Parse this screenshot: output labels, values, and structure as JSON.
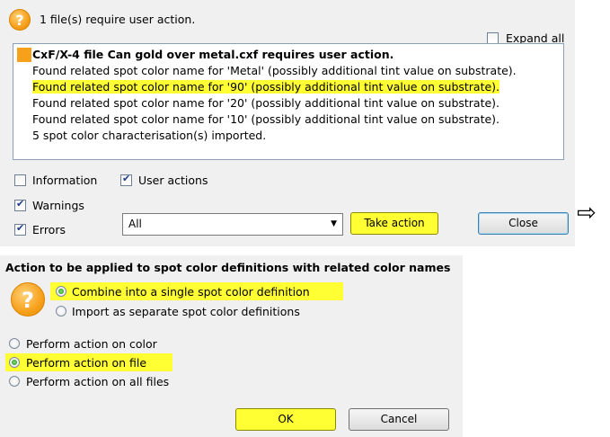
{
  "dialog1": {
    "header_text": "1 file(s) require user action.",
    "expand_all_label": "Expand all",
    "expand_all_checked": false,
    "messages": {
      "title": "CxF/X-4 file Can gold over metal.cxf requires user action.",
      "lines": [
        "Found related spot color name for 'Metal' (possibly additional tint value on substrate).",
        "Found related spot color name for '90' (possibly additional tint value on substrate).",
        "Found related spot color name for '20' (possibly additional tint value on substrate).",
        "Found related spot color name for '10' (possibly additional tint value on substrate).",
        "5 spot color characterisation(s) imported."
      ]
    },
    "filters": {
      "information_label": "Information",
      "information_checked": false,
      "user_actions_label": "User actions",
      "user_actions_checked": true,
      "warnings_label": "Warnings",
      "warnings_checked": true,
      "errors_label": "Errors",
      "errors_checked": true
    },
    "dropdown_value": "All",
    "take_action_label": "Take action",
    "close_label": "Close",
    "highlight_color": "#ffff33",
    "icon": "question-icon"
  },
  "dialog2": {
    "title": "Action to be applied to spot color definitions with related color names",
    "options_group1": [
      {
        "label": "Combine into a single spot color definition",
        "selected": true
      },
      {
        "label": "Import as separate spot color definitions",
        "selected": false
      }
    ],
    "options_group2": [
      {
        "label": "Perform action on color",
        "selected": false
      },
      {
        "label": "Perform action on file",
        "selected": true
      },
      {
        "label": "Perform action on all files",
        "selected": false
      }
    ],
    "ok_label": "OK",
    "cancel_label": "Cancel",
    "icon": "question-icon"
  }
}
